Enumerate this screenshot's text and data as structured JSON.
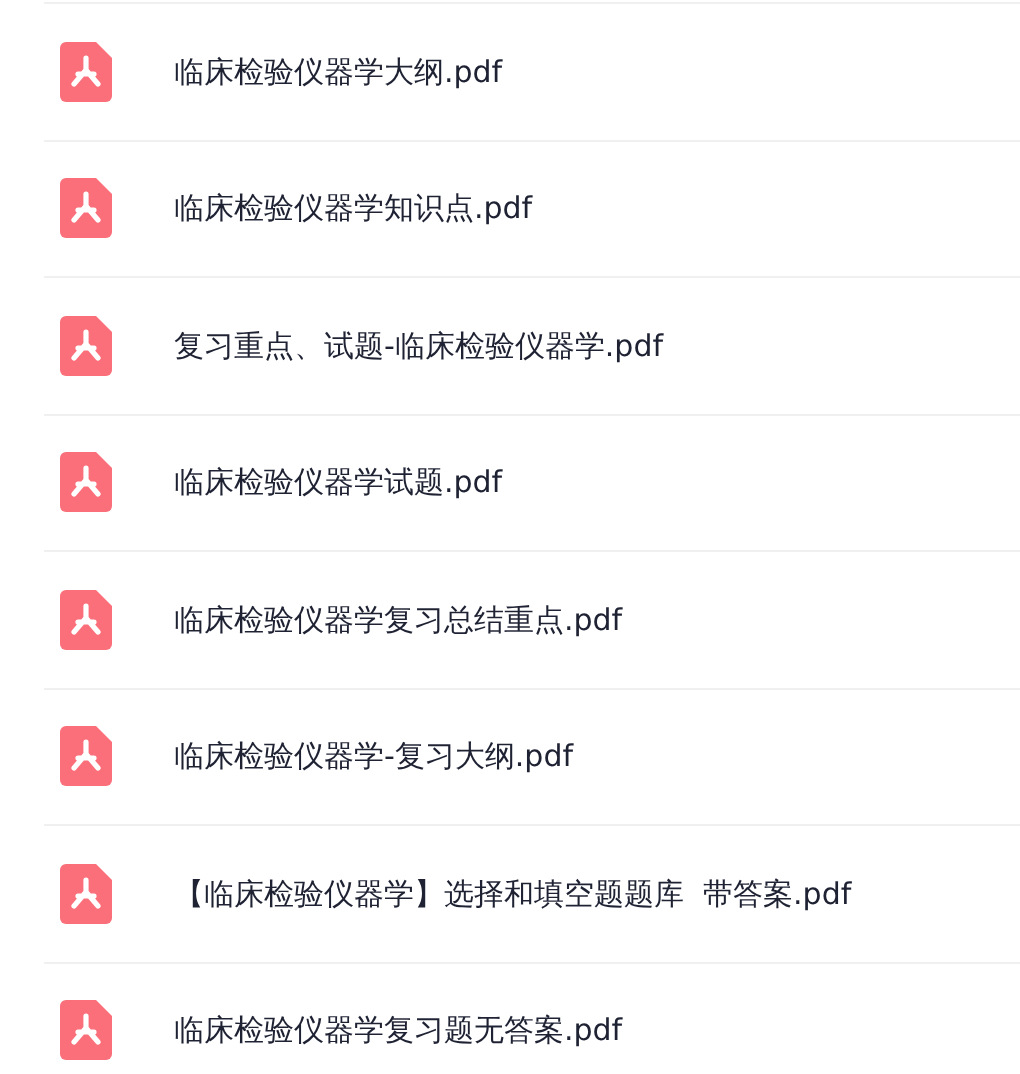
{
  "files": [
    {
      "name": "临床检验仪器学大纲.pdf",
      "kind": "pdf"
    },
    {
      "name": "临床检验仪器学知识点.pdf",
      "kind": "pdf"
    },
    {
      "name": "复习重点、试题-临床检验仪器学.pdf",
      "kind": "pdf"
    },
    {
      "name": "临床检验仪器学试题.pdf",
      "kind": "pdf"
    },
    {
      "name": "临床检验仪器学复习总结重点.pdf",
      "kind": "pdf"
    },
    {
      "name": "临床检验仪器学-复习大纲.pdf",
      "kind": "pdf"
    },
    {
      "name": "【临床检验仪器学】选择和填空题题库  带答案.pdf",
      "kind": "pdf"
    },
    {
      "name": "临床检验仪器学复习题无答案.pdf",
      "kind": "pdf"
    }
  ]
}
